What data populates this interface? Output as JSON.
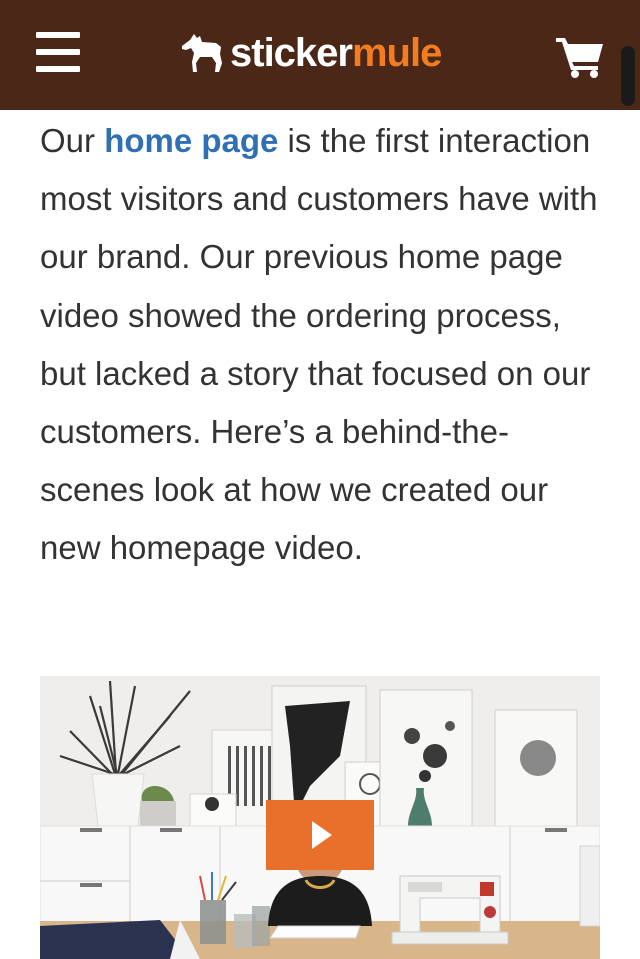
{
  "header": {
    "logo_word_1": "sticker",
    "logo_word_2": "mule",
    "background_color": "#4a2717",
    "accent_color": "#f47c20",
    "menu_icon": "hamburger-menu-icon",
    "cart_icon": "shopping-cart-icon"
  },
  "article": {
    "intro_before_link": "Our ",
    "link_text": "home page",
    "text_after_link": " is the first interaction most visitors and customers have with our brand. Our previous home page video showed the ordering process, but lacked a story that focused on our customers. Here’s a behind-the-scenes look at how we created our new homepage video.",
    "link_color": "#2f6fb3"
  },
  "video": {
    "play_icon": "play-icon",
    "play_button_color": "#e8702a"
  }
}
